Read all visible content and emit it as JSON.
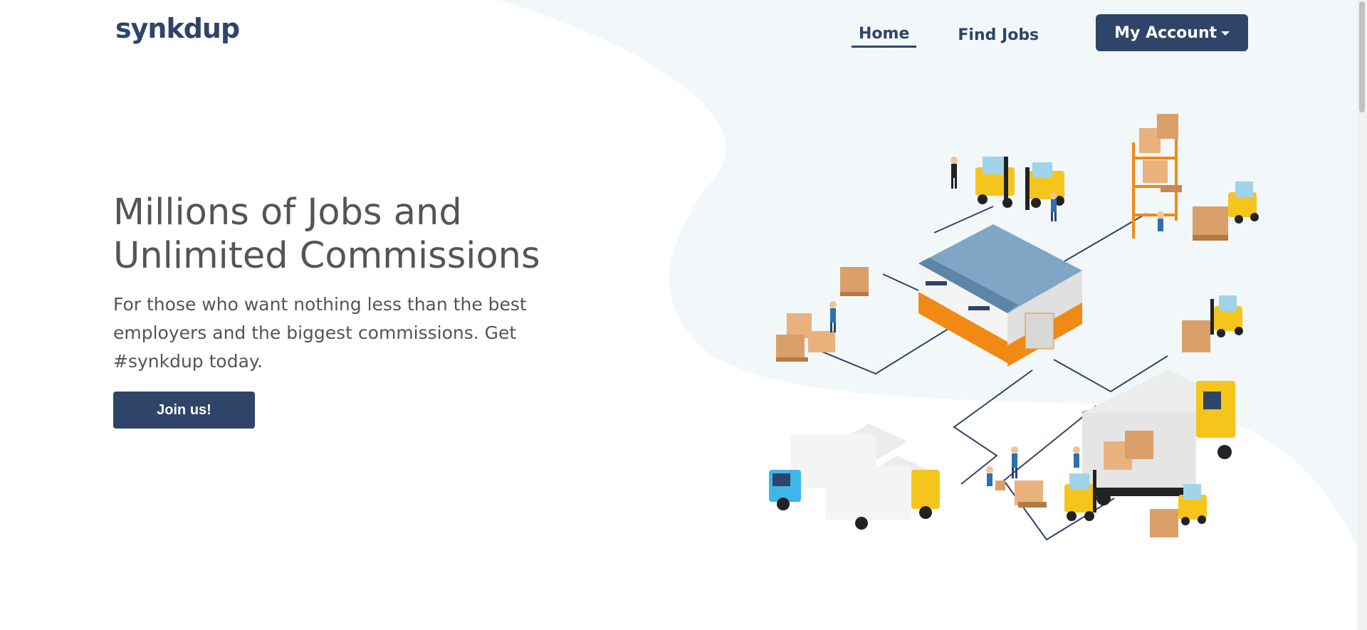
{
  "brand": {
    "logo_text": "synkdup",
    "primary_color": "#2e4569",
    "background_blob_color": "#f2f7f9"
  },
  "nav": {
    "home_label": "Home",
    "find_jobs_label": "Find Jobs",
    "account_label": "My Account",
    "active_item": "Home"
  },
  "hero": {
    "title": "Millions of Jobs and Unlimited Commissions",
    "body": "For those who want nothing less than the best employers and the biggest commissions. Get #synkdup today.",
    "cta_label": "Join us!"
  },
  "illustration": {
    "subject": "isometric logistics warehouse with forklifts, trucks, pallets and workers",
    "icon_names": [
      "warehouse-icon",
      "forklift-icon",
      "truck-icon",
      "pallet-icon",
      "worker-icon",
      "shelf-icon"
    ]
  }
}
